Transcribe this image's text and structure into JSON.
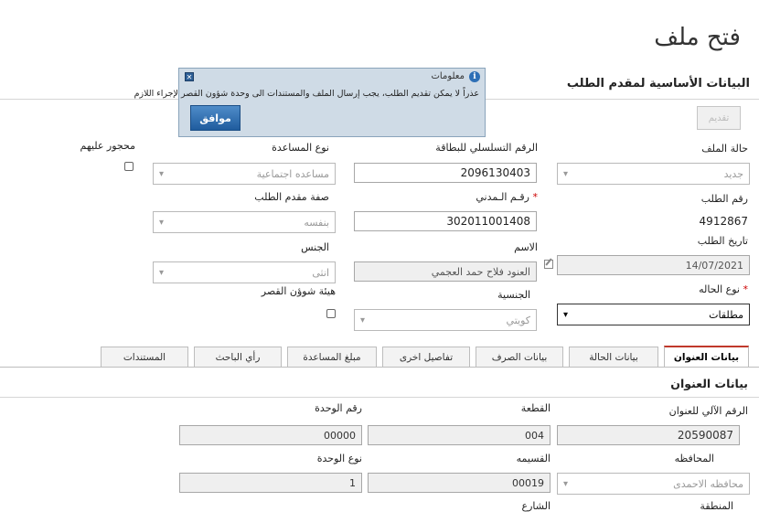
{
  "page": {
    "title": "فتح ملف",
    "section_title": "البيانات الأساسية لمقدم الطلب"
  },
  "toolbar": {
    "submit_label": "تقديم"
  },
  "dialog": {
    "title": "معلومات",
    "message": "عذراً لا يمكن تقديم الطلب، يجب إرسال الملف والمستندات الى وحدة شؤون القصر لإجراء اللازم",
    "ok_label": "موافق",
    "close_glyph": "✕",
    "info_glyph": "i"
  },
  "form": {
    "file_status": {
      "label": "حالة الملف",
      "value": "جديد"
    },
    "card_serial": {
      "label": "الرقم التسلسلي للبطاقة",
      "value": "2096130403"
    },
    "assistance_type": {
      "label": "نوع المساعدة",
      "value": "مساعده اجتماعية"
    },
    "restricted": {
      "label": "محجور عليهم"
    },
    "request_number": {
      "label": "رقم الطلب",
      "value": "4912867"
    },
    "civil_id": {
      "label": "رقـم الـمدني",
      "required": "*",
      "value": "302011001408"
    },
    "applicant_capacity": {
      "label": "صفة مقدم الطلب",
      "value": "بنفسه"
    },
    "request_date": {
      "label": "تاريخ الطلب",
      "value": "14/07/2021"
    },
    "name": {
      "label": "الاسم",
      "value": "العنود فلاح حمد العجمي"
    },
    "gender": {
      "label": "الجنس",
      "value": "انثى"
    },
    "case_type": {
      "label": "نوع الحاله",
      "required": "*",
      "value": "مطلقات"
    },
    "nationality": {
      "label": "الجنسية",
      "value": "كويتي"
    },
    "minors_authority": {
      "label": "هيئة شوؤن القصر"
    }
  },
  "tabs": [
    {
      "label": "بيانات العنوان"
    },
    {
      "label": "بيانات الحالة"
    },
    {
      "label": "بيانات الصرف"
    },
    {
      "label": "تفاصيل اخرى"
    },
    {
      "label": "مبلغ المساعدة"
    },
    {
      "label": "رأي الباحث"
    },
    {
      "label": "المستندات"
    }
  ],
  "address": {
    "section_title": "بيانات العنوان",
    "auto_number": {
      "label": "الرقم الآلي للعنوان",
      "value": "20590087"
    },
    "block": {
      "label": "القطعة",
      "value": "004"
    },
    "unit_number": {
      "label": "رقم الوحدة",
      "value": "00000"
    },
    "governorate": {
      "label": "المحافظه",
      "value": "محافظه الاحمدى"
    },
    "plot": {
      "label": "القسيمه",
      "value": "00019"
    },
    "unit_type": {
      "label": "نوع الوحدة",
      "value": "1"
    },
    "area_label": "المنطقة",
    "street_label": "الشارع"
  },
  "icons": {
    "chevron": "▾",
    "chevron_active": "⌄"
  }
}
